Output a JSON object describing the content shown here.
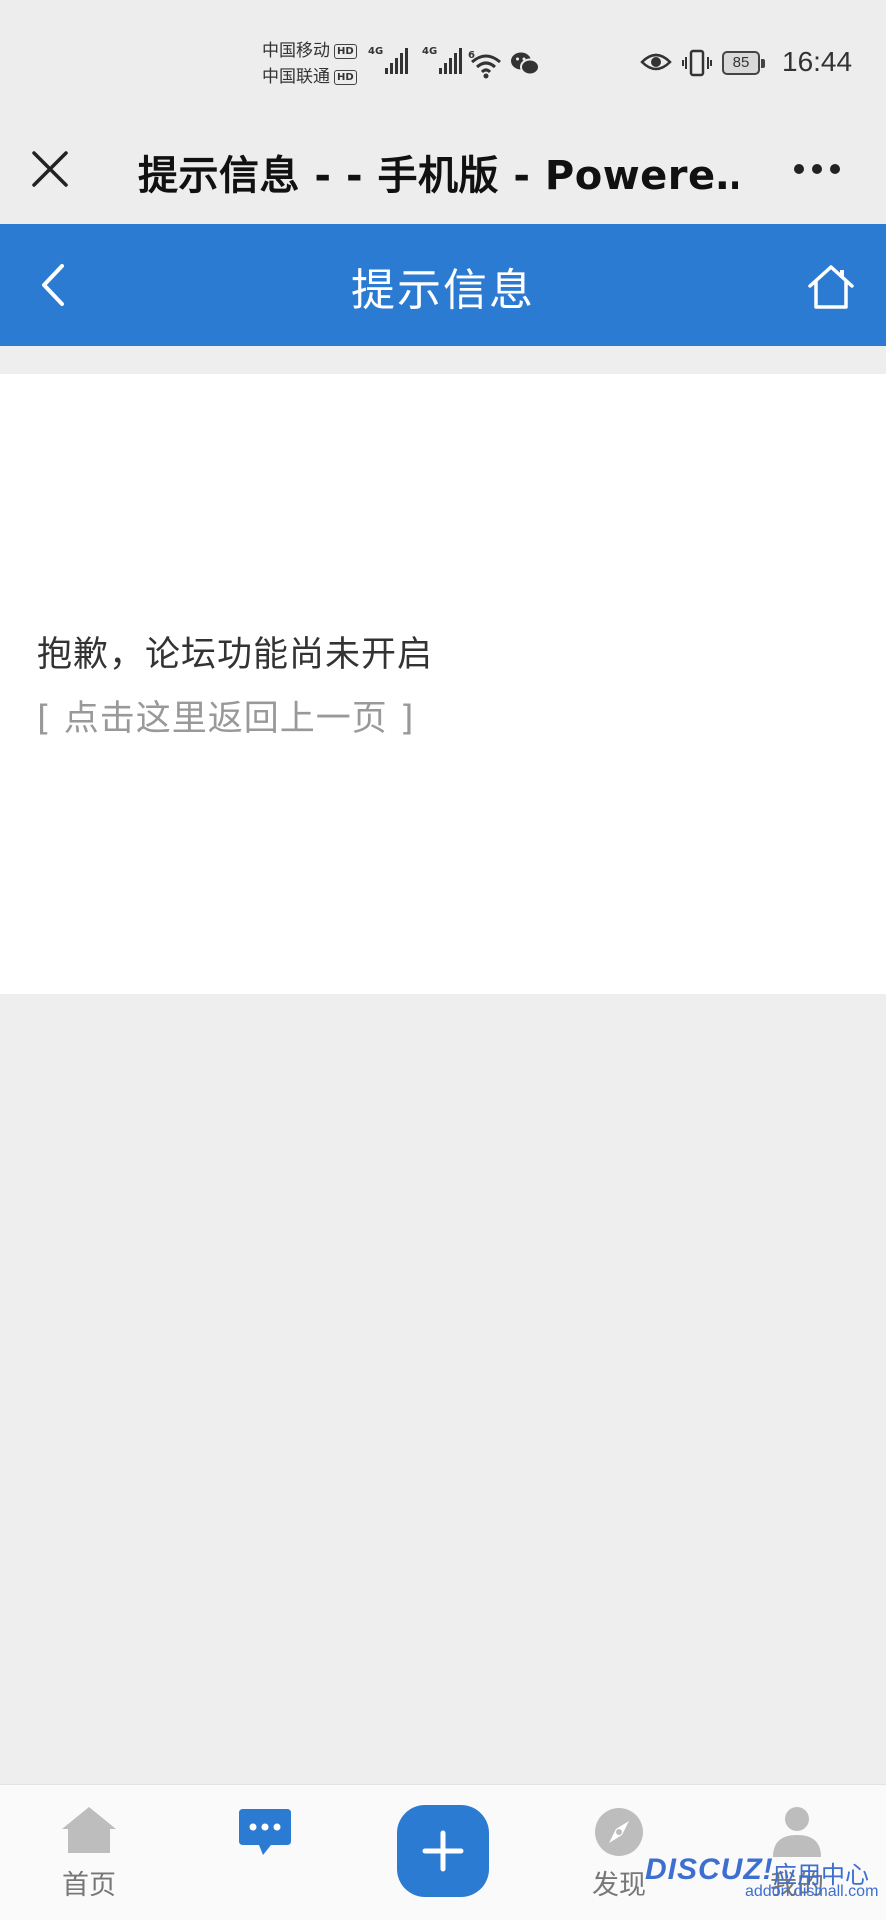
{
  "status_bar": {
    "carrier_1": "中国移动",
    "carrier_2": "中国联通",
    "hd_label": "HD",
    "net_1": "4G",
    "net_2": "4G",
    "wifi_label": "6",
    "battery": "85",
    "time": "16:44"
  },
  "wechat_nav": {
    "title": "提示信息 - - 手机版 - Powere…"
  },
  "header": {
    "title": "提示信息"
  },
  "message": {
    "text": "抱歉，论坛功能尚未开启",
    "back_link": "[ 点击这里返回上一页 ]"
  },
  "tabs": [
    {
      "label": "首页",
      "icon": "house-icon"
    },
    {
      "label": "",
      "icon": "chat-bubble-icon"
    },
    {
      "label": "",
      "icon": "plus-icon"
    },
    {
      "label": "发现",
      "icon": "compass-icon"
    },
    {
      "label": "我的",
      "icon": "user-icon"
    }
  ],
  "watermark": {
    "logo": "DISCUZ!",
    "app_center": "应用中心",
    "url": "addon.dismall.com"
  },
  "colors": {
    "brand_blue": "#2c7bd3",
    "background": "#eeeeee",
    "card": "#ffffff"
  }
}
